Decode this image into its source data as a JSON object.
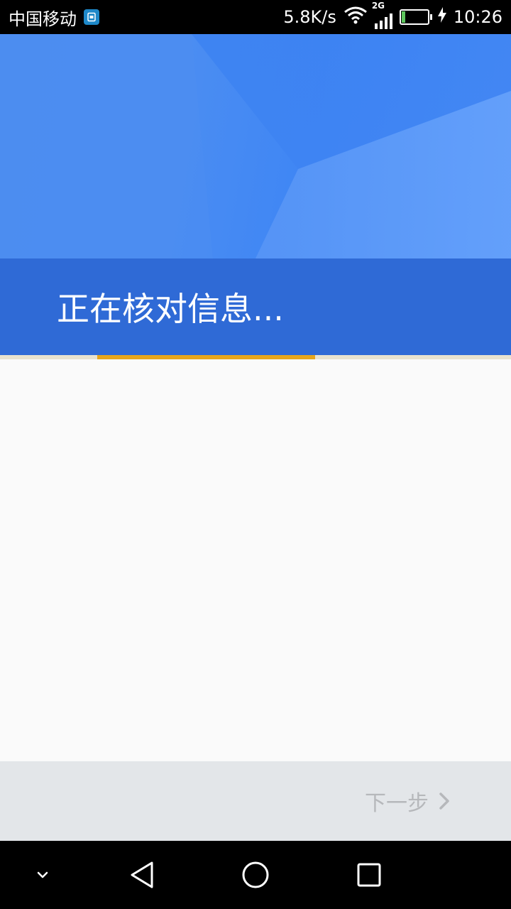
{
  "status_bar": {
    "carrier": "中国移动",
    "net_speed": "5.8K/s",
    "network_type": "2G",
    "battery_level": "14",
    "time": "10:26",
    "icons": [
      "sim-card-icon",
      "wifi-icon",
      "signal-icon",
      "battery-icon",
      "charging-icon"
    ]
  },
  "header": {
    "title": "正在核对信息..."
  },
  "progress": {
    "start_fraction": 0.19,
    "end_fraction": 0.617,
    "track_color": "#e8e2cf",
    "fill_color": "#e7a51b"
  },
  "footer": {
    "next_label": "下一步",
    "next_icon": "chevron-right-icon"
  },
  "nav_bar": {
    "icons": [
      "chevron-down-icon",
      "back-icon",
      "home-icon",
      "recents-icon"
    ]
  },
  "colors": {
    "hero_blue": "#4a8cf0",
    "title_band": "#2f6ad6",
    "action_bar": "#e3e6e9",
    "disabled_text": "#b6b8bb"
  }
}
